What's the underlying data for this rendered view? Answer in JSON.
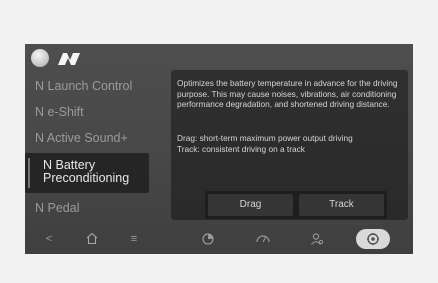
{
  "menu": {
    "items": [
      {
        "label": "N Launch Control"
      },
      {
        "label": "N e-Shift"
      },
      {
        "label": "N Active Sound+"
      },
      {
        "label_line1": "N Battery",
        "label_line2": "Preconditioning"
      },
      {
        "label": "N Pedal"
      }
    ]
  },
  "panel": {
    "description": "Optimizes the battery temperature in advance for the driving purpose. This may cause noises, vibrations, air conditioning performance degradation, and shortened driving distance.",
    "drag_info": "Drag: short-term maximum power output driving",
    "track_info": "Track: consistent driving on a track",
    "buttons": {
      "drag": "Drag",
      "track": "Track"
    }
  },
  "bottom_nav": {
    "back": "<",
    "menu": "≡"
  }
}
